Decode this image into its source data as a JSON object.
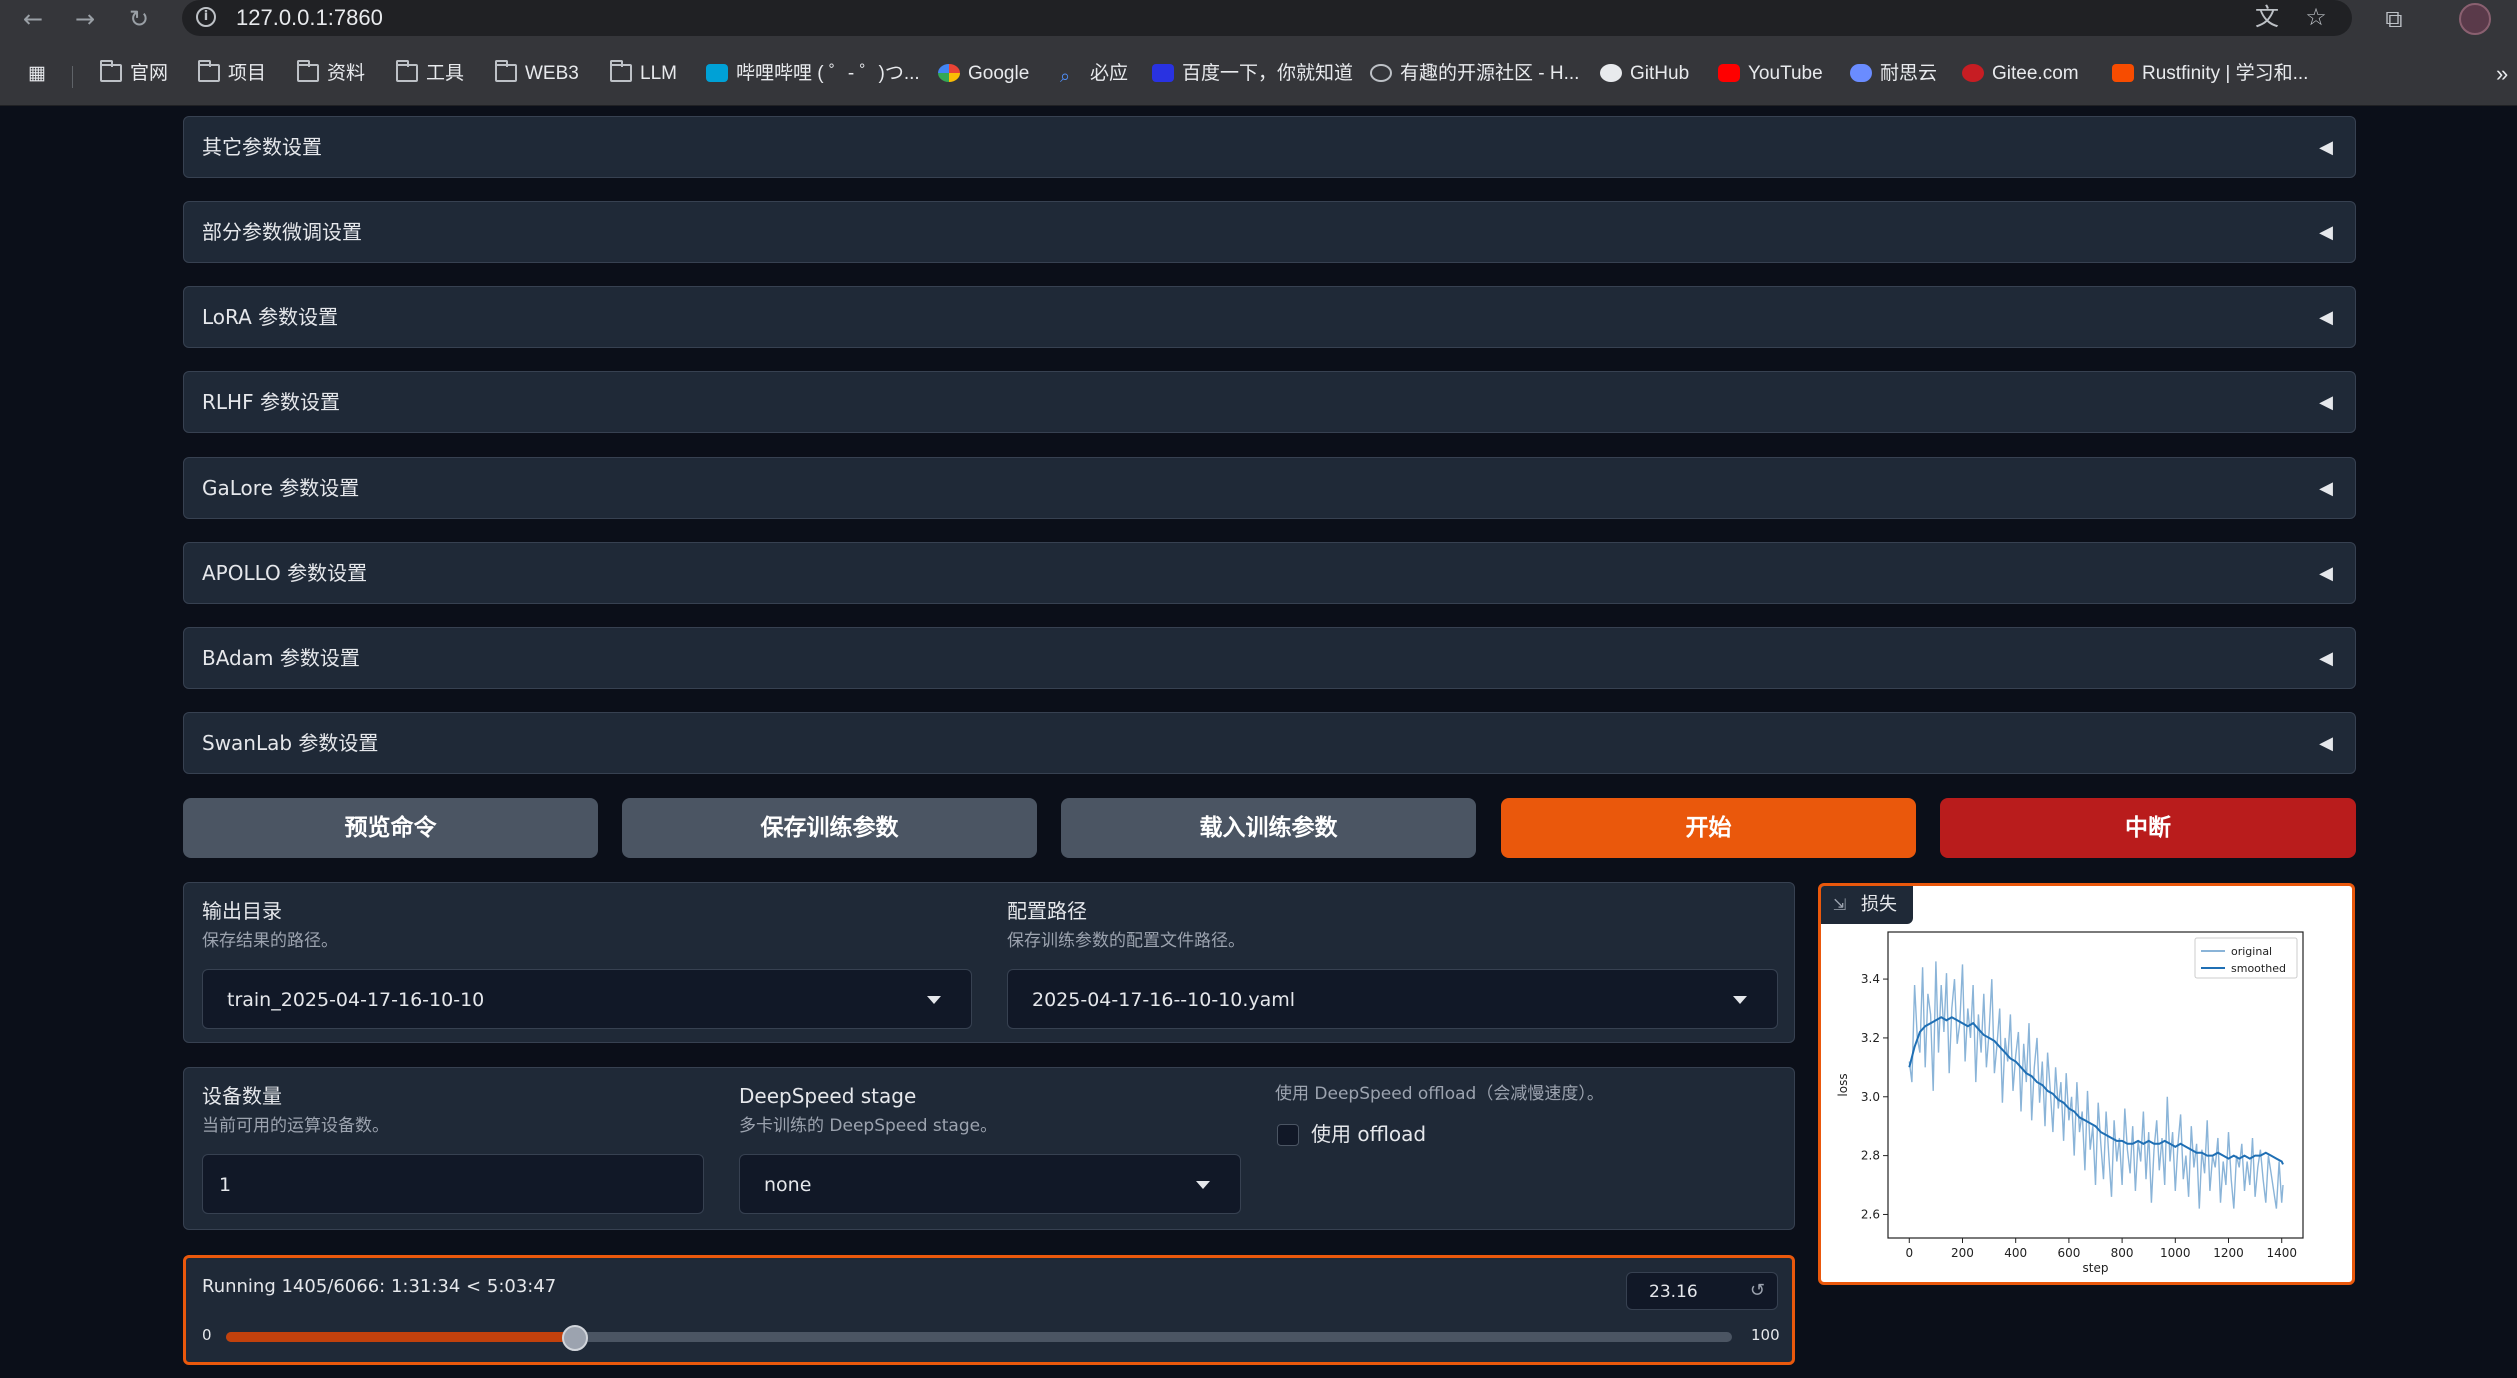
{
  "browser": {
    "url": "127.0.0.1:7860",
    "bookmarks": [
      {
        "label": "官网",
        "icon": "folder-icon"
      },
      {
        "label": "项目",
        "icon": "folder-icon"
      },
      {
        "label": "资料",
        "icon": "folder-icon"
      },
      {
        "label": "工具",
        "icon": "folder-icon"
      },
      {
        "label": "WEB3",
        "icon": "folder-icon"
      },
      {
        "label": "LLM",
        "icon": "folder-icon"
      },
      {
        "label": "哔哩哔哩 ( ゜- ゜)つ...",
        "icon": "bilibili-icon"
      },
      {
        "label": "Google",
        "icon": "google-icon"
      },
      {
        "label": "必应",
        "icon": "bing-icon"
      },
      {
        "label": "百度一下，你就知道",
        "icon": "baidu-icon"
      },
      {
        "label": "有趣的开源社区 - H...",
        "icon": "hellogithub-icon"
      },
      {
        "label": "GitHub",
        "icon": "github-icon"
      },
      {
        "label": "YouTube",
        "icon": "youtube-icon"
      },
      {
        "label": "耐思云",
        "icon": "cloud-icon"
      },
      {
        "label": "Gitee.com",
        "icon": "gitee-icon"
      },
      {
        "label": "Rustfinity | 学习和...",
        "icon": "rust-icon"
      }
    ],
    "more": "»"
  },
  "accordions": [
    {
      "label": "其它参数设置"
    },
    {
      "label": "部分参数微调设置"
    },
    {
      "label": "LoRA 参数设置"
    },
    {
      "label": "RLHF 参数设置"
    },
    {
      "label": "GaLore 参数设置"
    },
    {
      "label": "APOLLO 参数设置"
    },
    {
      "label": "BAdam 参数设置"
    },
    {
      "label": "SwanLab 参数设置"
    }
  ],
  "accordion_arrow": "◀",
  "actions": {
    "preview": "预览命令",
    "save": "保存训练参数",
    "load": "载入训练参数",
    "start": "开始",
    "abort": "中断"
  },
  "output": {
    "output_dir_label": "输出目录",
    "output_dir_info": "保存结果的路径。",
    "output_dir_value": "train_2025-04-17-16-10-10",
    "config_path_label": "配置路径",
    "config_path_info": "保存训练参数的配置文件路径。",
    "config_path_value": "2025-04-17-16--10-10.yaml"
  },
  "devices": {
    "count_label": "设备数量",
    "count_info": "当前可用的运算设备数。",
    "count_value": "1",
    "ds_stage_label": "DeepSpeed stage",
    "ds_stage_info": "多卡训练的 DeepSpeed stage。",
    "ds_stage_value": "none",
    "offload_info": "使用 DeepSpeed offload（会减慢速度）。",
    "offload_label": "使用 offload",
    "offload_checked": false
  },
  "progress": {
    "status": "Running 1405/6066: 1:31:34 < 5:03:47",
    "value": "23.16",
    "percent": 23.16,
    "min": "0",
    "max": "100",
    "reset": "↺"
  },
  "loss_panel": {
    "label": "损失"
  },
  "chart_data": {
    "type": "line",
    "xlabel": "step",
    "ylabel": "loss",
    "xlim": [
      -80,
      1480
    ],
    "ylim": [
      2.52,
      3.56
    ],
    "xticks": [
      0,
      200,
      400,
      600,
      800,
      1000,
      1200,
      1400
    ],
    "yticks": [
      2.6,
      2.8,
      3.0,
      3.2,
      3.4
    ],
    "legend_position": "top-right",
    "series": [
      {
        "name": "original",
        "color": "#8ab4d8",
        "x": [
          0,
          10,
          20,
          30,
          40,
          50,
          60,
          70,
          80,
          90,
          100,
          110,
          120,
          130,
          140,
          150,
          160,
          170,
          180,
          190,
          200,
          210,
          220,
          230,
          240,
          250,
          260,
          270,
          280,
          290,
          300,
          310,
          320,
          330,
          340,
          350,
          360,
          370,
          380,
          390,
          400,
          410,
          420,
          430,
          440,
          450,
          460,
          470,
          480,
          490,
          500,
          510,
          520,
          530,
          540,
          550,
          560,
          570,
          580,
          590,
          600,
          610,
          620,
          630,
          640,
          650,
          660,
          670,
          680,
          690,
          700,
          710,
          720,
          730,
          740,
          750,
          760,
          770,
          780,
          790,
          800,
          810,
          820,
          830,
          840,
          850,
          860,
          870,
          880,
          890,
          900,
          910,
          920,
          930,
          940,
          950,
          960,
          970,
          980,
          990,
          1000,
          1010,
          1020,
          1030,
          1040,
          1050,
          1060,
          1070,
          1080,
          1090,
          1100,
          1110,
          1120,
          1130,
          1140,
          1150,
          1160,
          1170,
          1180,
          1190,
          1200,
          1210,
          1220,
          1230,
          1240,
          1250,
          1260,
          1270,
          1280,
          1290,
          1300,
          1310,
          1320,
          1330,
          1340,
          1350,
          1360,
          1370,
          1380,
          1390,
          1400,
          1405
        ],
        "y": [
          3.12,
          3.05,
          3.38,
          3.2,
          3.15,
          3.44,
          3.1,
          3.35,
          3.28,
          3.02,
          3.46,
          3.15,
          3.38,
          3.22,
          3.42,
          3.08,
          3.3,
          3.4,
          3.18,
          3.25,
          3.45,
          3.12,
          3.3,
          3.2,
          3.38,
          3.05,
          3.28,
          3.15,
          3.35,
          3.1,
          3.22,
          3.4,
          3.08,
          3.18,
          3.3,
          2.98,
          3.2,
          3.12,
          3.28,
          3.02,
          3.14,
          3.22,
          2.95,
          3.18,
          3.05,
          3.25,
          2.92,
          3.1,
          3.2,
          2.98,
          3.12,
          2.9,
          3.15,
          3.02,
          2.88,
          3.1,
          2.96,
          3.05,
          2.85,
          3.08,
          2.92,
          3.0,
          2.8,
          3.05,
          2.88,
          2.95,
          2.75,
          3.02,
          2.82,
          2.9,
          2.7,
          2.98,
          2.84,
          2.72,
          2.95,
          2.8,
          2.66,
          2.92,
          2.78,
          2.86,
          2.7,
          2.96,
          2.82,
          2.74,
          2.9,
          2.68,
          2.85,
          2.78,
          2.95,
          2.72,
          2.88,
          2.64,
          2.82,
          2.92,
          2.75,
          2.86,
          2.7,
          3.0,
          2.78,
          2.88,
          2.68,
          2.84,
          2.94,
          2.72,
          2.8,
          2.66,
          2.9,
          2.76,
          2.84,
          2.62,
          2.82,
          2.74,
          2.92,
          2.68,
          2.8,
          2.76,
          2.86,
          2.64,
          2.78,
          2.7,
          2.88,
          2.72,
          2.62,
          2.8,
          2.76,
          2.84,
          2.68,
          2.78,
          2.7,
          2.86,
          2.66,
          2.76,
          2.82,
          2.72,
          2.64,
          2.8,
          2.74,
          2.68,
          2.62,
          2.78,
          2.64,
          2.7
        ]
      },
      {
        "name": "smoothed",
        "color": "#1f6fb4",
        "x": [
          0,
          20,
          40,
          60,
          80,
          100,
          120,
          140,
          160,
          180,
          200,
          220,
          240,
          260,
          280,
          300,
          320,
          340,
          360,
          380,
          400,
          420,
          440,
          460,
          480,
          500,
          520,
          540,
          560,
          580,
          600,
          620,
          640,
          660,
          680,
          700,
          720,
          740,
          760,
          780,
          800,
          820,
          840,
          860,
          880,
          900,
          920,
          940,
          960,
          980,
          1000,
          1020,
          1040,
          1060,
          1080,
          1100,
          1120,
          1140,
          1160,
          1180,
          1200,
          1220,
          1240,
          1260,
          1280,
          1300,
          1320,
          1340,
          1360,
          1380,
          1400,
          1405
        ],
        "y": [
          3.1,
          3.17,
          3.22,
          3.24,
          3.25,
          3.26,
          3.27,
          3.26,
          3.27,
          3.26,
          3.25,
          3.24,
          3.25,
          3.23,
          3.21,
          3.2,
          3.19,
          3.17,
          3.15,
          3.13,
          3.12,
          3.1,
          3.08,
          3.07,
          3.05,
          3.04,
          3.02,
          3.01,
          2.99,
          2.98,
          2.96,
          2.95,
          2.93,
          2.92,
          2.91,
          2.9,
          2.88,
          2.87,
          2.86,
          2.85,
          2.85,
          2.84,
          2.84,
          2.85,
          2.84,
          2.85,
          2.84,
          2.84,
          2.85,
          2.84,
          2.83,
          2.84,
          2.83,
          2.82,
          2.81,
          2.81,
          2.8,
          2.8,
          2.81,
          2.8,
          2.79,
          2.8,
          2.79,
          2.8,
          2.79,
          2.8,
          2.8,
          2.81,
          2.8,
          2.79,
          2.78,
          2.77
        ]
      }
    ]
  }
}
